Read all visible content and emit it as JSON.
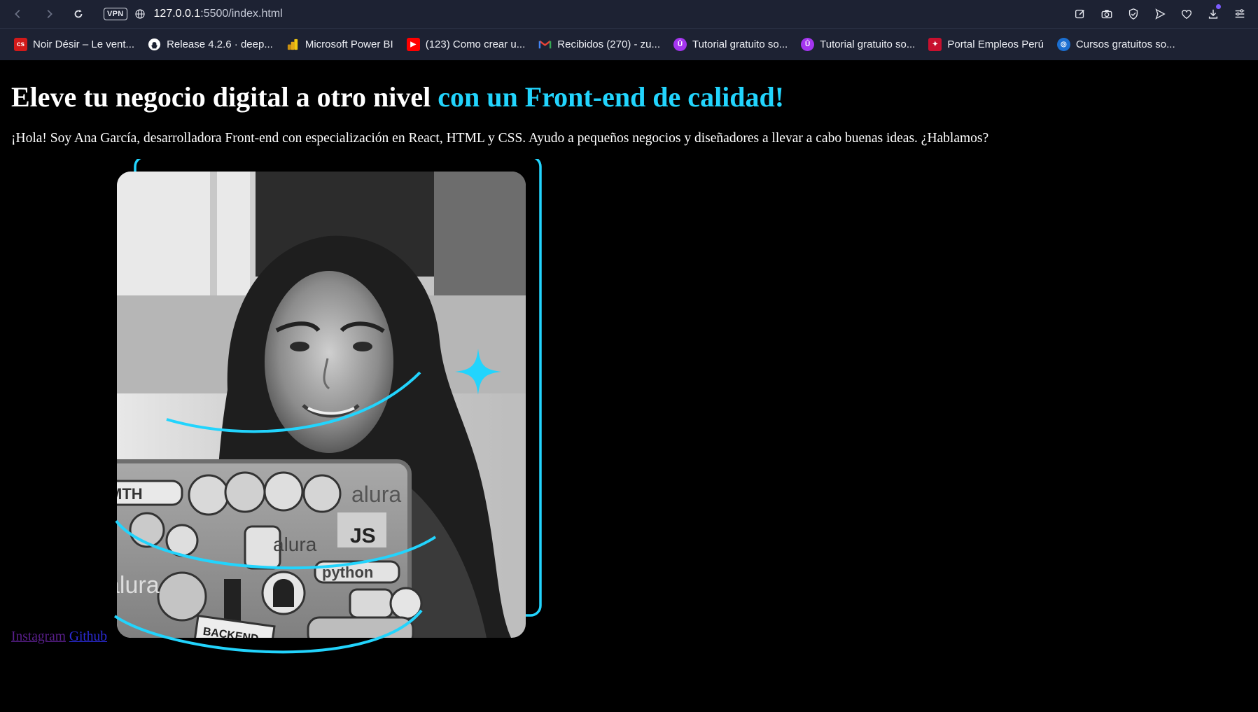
{
  "browser": {
    "vpn_label": "VPN",
    "url_host": "127.0.0.1",
    "url_path": ":5500/index.html",
    "bookmarks": [
      {
        "label": "Noir Désir – Le vent...",
        "icon": "cs-icon",
        "color": "#d21a1a",
        "glyph": "cs"
      },
      {
        "label": "Release 4.2.6 · deep...",
        "icon": "github-icon",
        "color": "#ffffff",
        "glyph": ""
      },
      {
        "label": "Microsoft Power BI",
        "icon": "power-bi-icon",
        "color": "#f2c811",
        "glyph": ""
      },
      {
        "label": "(123) Como crear u...",
        "icon": "youtube-icon",
        "color": "#ff0000",
        "glyph": "▶"
      },
      {
        "label": "Recibidos (270) - zu...",
        "icon": "gmail-icon",
        "color": "#ea4335",
        "glyph": "M"
      },
      {
        "label": "Tutorial gratuito so...",
        "icon": "udemy-icon",
        "color": "#a435f0",
        "glyph": "Û"
      },
      {
        "label": "Tutorial gratuito so...",
        "icon": "udemy-icon",
        "color": "#a435f0",
        "glyph": "Û"
      },
      {
        "label": "Portal Empleos Perú",
        "icon": "peru-seal-icon",
        "color": "#c8102e",
        "glyph": "✦"
      },
      {
        "label": "Cursos gratuitos so...",
        "icon": "course-globe-icon",
        "color": "#1b6fd1",
        "glyph": "◎"
      }
    ]
  },
  "hero": {
    "title_main": "Eleve tu negocio digital a otro nivel ",
    "title_accent": "con un Front-end de calidad!",
    "intro": "¡Hola! Soy Ana García, desarrolladora Front-end con especialización en React, HTML y CSS. Ayudo a pequeños negocios y diseñadores a llevar a cabo buenas ideas. ¿Hablamos?",
    "accent_color": "#22d4fd"
  },
  "photo_stickers": [
    "MTH",
    "alura",
    "JS",
    "alura",
    "python",
    "BACKEND",
    "alura"
  ],
  "footer": {
    "instagram": "Instagram",
    "github": "Github"
  }
}
